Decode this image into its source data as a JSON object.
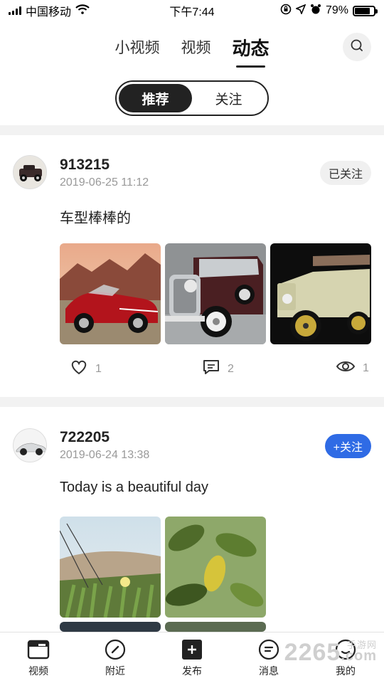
{
  "status_bar": {
    "carrier": "中国移动",
    "time": "下午7:44",
    "battery": "79%",
    "battery_level": 0.79
  },
  "top_tabs": [
    {
      "label": "小视频",
      "active": false
    },
    {
      "label": "视频",
      "active": false
    },
    {
      "label": "动态",
      "active": true
    }
  ],
  "segments": [
    {
      "label": "推荐",
      "active": true
    },
    {
      "label": "关注",
      "active": false
    }
  ],
  "posts": [
    {
      "username": "913215",
      "timestamp": "2019-06-25 11:12",
      "follow_label": "已关注",
      "text": "车型棒棒的",
      "likes": "1",
      "comments": "2",
      "views": "1"
    },
    {
      "username": "722205",
      "timestamp": "2019-06-24 13:38",
      "follow_label": "+关注",
      "text": "Today is  a beautiful day"
    }
  ],
  "bottom_nav": [
    {
      "label": "视频",
      "icon": "video-icon"
    },
    {
      "label": "附近",
      "icon": "compass-icon"
    },
    {
      "label": "发布",
      "icon": "plus-icon"
    },
    {
      "label": "消息",
      "icon": "message-icon"
    },
    {
      "label": "我的",
      "icon": "profile-icon"
    }
  ],
  "watermark": {
    "brand": "2265",
    "suffix": ".com",
    "tag": "手游网"
  },
  "colors": {
    "accent_blue": "#2f6be5",
    "dark": "#222222",
    "muted": "#999999"
  }
}
